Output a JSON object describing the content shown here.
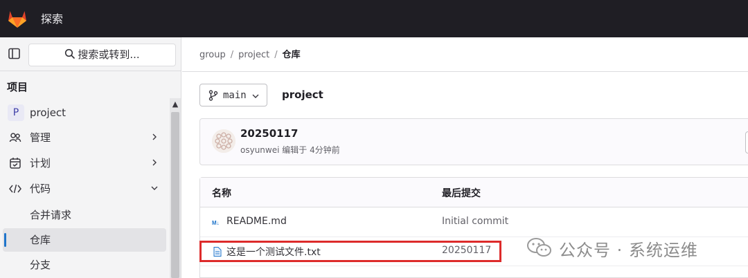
{
  "topbar": {
    "title": "探索"
  },
  "sidebar": {
    "search_label": "搜索或转到...",
    "section_title": "项目",
    "items": [
      {
        "label": "project",
        "avatar_letter": "P"
      },
      {
        "label": "管理"
      },
      {
        "label": "计划"
      },
      {
        "label": "代码"
      },
      {
        "label": "合并请求"
      },
      {
        "label": "仓库"
      },
      {
        "label": "分支"
      }
    ]
  },
  "breadcrumb": [
    "group",
    "project",
    "仓库"
  ],
  "branch": {
    "name": "main"
  },
  "repo": {
    "name": "project"
  },
  "commit": {
    "title": "20250117",
    "meta": "osyunwei 编辑于 4分钟前"
  },
  "table": {
    "headers": [
      "名称",
      "最后提交"
    ],
    "rows": [
      {
        "name": "README.md",
        "commit": "Initial commit"
      },
      {
        "name": "这是一个测试文件.txt",
        "commit": "20250117"
      }
    ]
  },
  "watermark": {
    "text": "公众号 · 系统运维"
  },
  "colors": {
    "topbar": "#1f1e24",
    "accent": "#1f75cb",
    "highlight": "#dd2b2b"
  }
}
